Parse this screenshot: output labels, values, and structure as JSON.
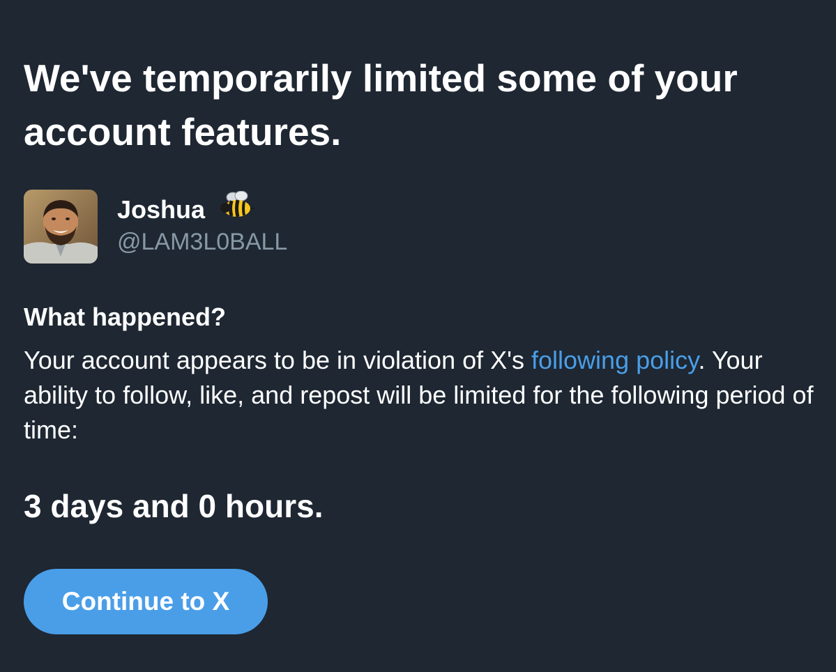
{
  "header": {
    "title": "We've temporarily limited some of your account features."
  },
  "profile": {
    "display_name": "Joshua",
    "name_emoji": "bee-icon",
    "handle": "@LAM3L0BALL",
    "avatar": "profile-photo"
  },
  "notice": {
    "heading": "What happened?",
    "text_before_link": "Your account appears to be in violation of X's ",
    "link_label": "following policy",
    "text_after_link": ". Your ability to follow, like, and repost will be limited for the following period of time:",
    "duration": "3 days and 0 hours."
  },
  "actions": {
    "continue_label": "Continue to X"
  },
  "colors": {
    "background": "#1e2732",
    "text": "#ffffff",
    "muted": "#8899a6",
    "accent": "#4a9ee8"
  }
}
